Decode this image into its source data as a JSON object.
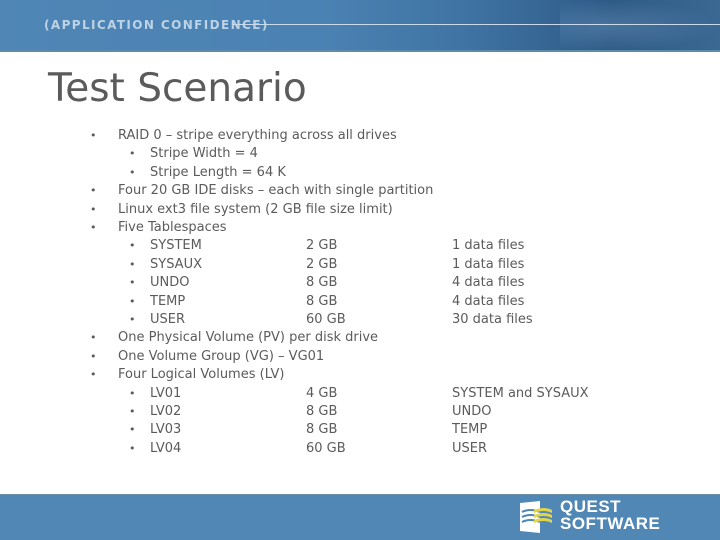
{
  "header": {
    "tagline": "(APPLICATION CONFIDENCE)",
    "color": "#4f86b6"
  },
  "slide": {
    "title": "Test Scenario",
    "items": [
      {
        "level": 1,
        "text": "RAID 0 – stripe everything across all drives"
      },
      {
        "level": 2,
        "text": "Stripe Width = 4"
      },
      {
        "level": 2,
        "text": "Stripe Length = 64 K"
      },
      {
        "level": 1,
        "text": "Four 20 GB IDE disks – each with single partition"
      },
      {
        "level": 1,
        "text": "Linux ext3 file system (2 GB file size limit)"
      },
      {
        "level": 1,
        "text": "Five Tablespaces"
      },
      {
        "level": 2,
        "text": "SYSTEM",
        "size": "2 GB",
        "note": "1 data files"
      },
      {
        "level": 2,
        "text": "SYSAUX",
        "size": "2 GB",
        "note": "1 data files"
      },
      {
        "level": 2,
        "text": "UNDO",
        "size": "8 GB",
        "note": "4 data files"
      },
      {
        "level": 2,
        "text": "TEMP",
        "size": "8 GB",
        "note": "4 data files"
      },
      {
        "level": 2,
        "text": "USER",
        "size": "60 GB",
        "note": "30 data files"
      },
      {
        "level": 1,
        "text": "One Physical Volume (PV) per disk drive"
      },
      {
        "level": 1,
        "text": "One Volume Group (VG) – VG01"
      },
      {
        "level": 1,
        "text": "Four Logical Volumes (LV)"
      },
      {
        "level": 2,
        "text": "LV01",
        "size": "4 GB",
        "note": "SYSTEM and SYSAUX"
      },
      {
        "level": 2,
        "text": "LV02",
        "size": "8 GB",
        "note": "UNDO"
      },
      {
        "level": 2,
        "text": "LV03",
        "size": "8 GB",
        "note": "TEMP"
      },
      {
        "level": 2,
        "text": "LV04",
        "size": "60 GB",
        "note": "USER"
      }
    ],
    "bullet_glyph": "•",
    "text_color": "#5b5b5b"
  },
  "footer": {
    "logo_line1": "QUEST",
    "logo_line2": "SOFTWARE",
    "logo_icon": "quest-logo-icon",
    "color": "#5087b5"
  }
}
